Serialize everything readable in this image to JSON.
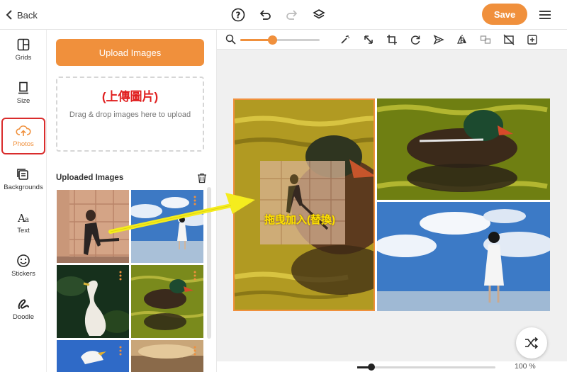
{
  "topbar": {
    "back_label": "Back",
    "save_label": "Save",
    "icons": [
      "help-icon",
      "undo-icon",
      "redo-icon",
      "layers-icon",
      "menu-icon"
    ]
  },
  "sidebar": {
    "items": [
      {
        "label": "Grids",
        "icon": "grid-icon"
      },
      {
        "label": "Size",
        "icon": "size-icon"
      },
      {
        "label": "Photos",
        "icon": "cloud-upload-icon",
        "active": true
      },
      {
        "label": "Backgrounds",
        "icon": "backgrounds-icon"
      },
      {
        "label": "Text",
        "icon": "text-icon"
      },
      {
        "label": "Stickers",
        "icon": "smiley-icon"
      },
      {
        "label": "Doodle",
        "icon": "doodle-icon"
      }
    ]
  },
  "panel": {
    "upload_button": "Upload Images",
    "annotation_upload": "(上傳圖片)",
    "dropzone_text": "Drag & drop images here to upload",
    "uploaded_title": "Uploaded Images"
  },
  "canvas": {
    "toolbar_icons": [
      "zoom-icon",
      "magic-wand-icon",
      "resize-icon",
      "crop-icon",
      "rotate-icon",
      "send-icon",
      "flip-icon",
      "swap-icon",
      "remove-icon",
      "add-icon"
    ],
    "image_zoom_fraction": 0.4,
    "drag_annotation": "拖曳加入(替換)"
  },
  "bottom": {
    "zoom_label": "100 %",
    "zoom_fraction": 0.1
  },
  "colors": {
    "accent": "#f0903c",
    "highlight": "#d92c2c",
    "annotation": "#ffe100"
  }
}
